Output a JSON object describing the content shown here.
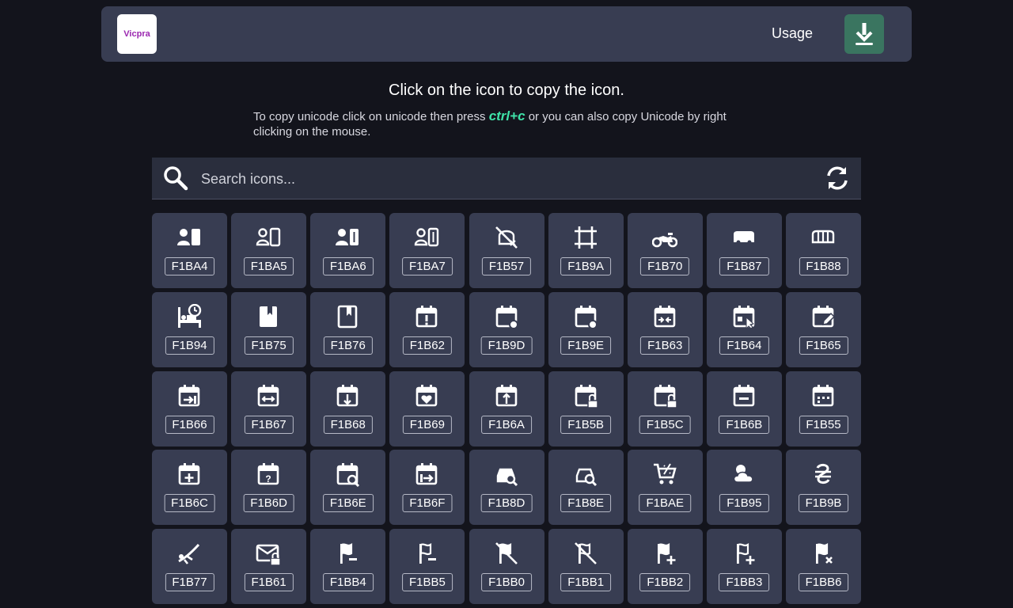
{
  "header": {
    "logo_text": "Vicpra",
    "usage_label": "Usage",
    "download_icon": "download-icon"
  },
  "instructions": {
    "headline": "Click on the icon to copy the icon.",
    "line_before": "To copy unicode click on unicode then press ",
    "shortcut": "ctrl+c",
    "line_after": " or you can also copy Unicode by right clicking on the mouse."
  },
  "search": {
    "placeholder": "Search icons...",
    "value": ""
  },
  "icons": [
    {
      "code": "F1BA4",
      "icon": "account-box-icon"
    },
    {
      "code": "F1BA5",
      "icon": "account-box-outline-icon"
    },
    {
      "code": "F1BA6",
      "icon": "account-box-plus-icon"
    },
    {
      "code": "F1BA7",
      "icon": "account-box-plus-outline-icon"
    },
    {
      "code": "F1B57",
      "icon": "bell-cancel-icon"
    },
    {
      "code": "F1B9A",
      "icon": "border-box-icon"
    },
    {
      "code": "F1B70",
      "icon": "motorbike-icon"
    },
    {
      "code": "F1B87",
      "icon": "bus-side-icon"
    },
    {
      "code": "F1B88",
      "icon": "bus-side-outline-icon"
    },
    {
      "code": "F1B94",
      "icon": "bed-clock-icon"
    },
    {
      "code": "F1B75",
      "icon": "book-bookmark-icon"
    },
    {
      "code": "F1B76",
      "icon": "book-bookmark-outline-icon"
    },
    {
      "code": "F1B62",
      "icon": "calendar-alert-icon"
    },
    {
      "code": "F1B9D",
      "icon": "calendar-badge-icon"
    },
    {
      "code": "F1B9E",
      "icon": "calendar-badge-outline-icon"
    },
    {
      "code": "F1B63",
      "icon": "calendar-collapse-icon"
    },
    {
      "code": "F1B64",
      "icon": "calendar-cursor-icon"
    },
    {
      "code": "F1B65",
      "icon": "calendar-edit-icon"
    },
    {
      "code": "F1B66",
      "icon": "calendar-end-icon"
    },
    {
      "code": "F1B67",
      "icon": "calendar-expand-icon"
    },
    {
      "code": "F1B68",
      "icon": "calendar-export-icon"
    },
    {
      "code": "F1B69",
      "icon": "calendar-heart-icon"
    },
    {
      "code": "F1B6A",
      "icon": "calendar-import-icon"
    },
    {
      "code": "F1B5B",
      "icon": "calendar-lock-open-icon"
    },
    {
      "code": "F1B5C",
      "icon": "calendar-lock-open-outline-icon"
    },
    {
      "code": "F1B6B",
      "icon": "calendar-minus-icon"
    },
    {
      "code": "F1B55",
      "icon": "calendar-dots-icon"
    },
    {
      "code": "F1B6C",
      "icon": "calendar-plus-icon"
    },
    {
      "code": "F1B6D",
      "icon": "calendar-question-icon"
    },
    {
      "code": "F1B6E",
      "icon": "calendar-search-icon"
    },
    {
      "code": "F1B6F",
      "icon": "calendar-start-icon"
    },
    {
      "code": "F1B8D",
      "icon": "car-search-icon"
    },
    {
      "code": "F1B8E",
      "icon": "car-search-outline-icon"
    },
    {
      "code": "F1BAE",
      "icon": "cart-percent-icon"
    },
    {
      "code": "F1B95",
      "icon": "cloud-sun-icon"
    },
    {
      "code": "F1B9B",
      "icon": "currency-hryvnia-icon"
    },
    {
      "code": "F1B77",
      "icon": "diving-icon"
    },
    {
      "code": "F1B61",
      "icon": "email-lock-outline-icon"
    },
    {
      "code": "F1BB4",
      "icon": "flag-minus-icon"
    },
    {
      "code": "F1BB5",
      "icon": "flag-minus-outline-icon"
    },
    {
      "code": "F1BB0",
      "icon": "flag-off-icon"
    },
    {
      "code": "F1BB1",
      "icon": "flag-off-outline-icon"
    },
    {
      "code": "F1BB2",
      "icon": "flag-plus-icon"
    },
    {
      "code": "F1BB3",
      "icon": "flag-plus-outline-icon"
    },
    {
      "code": "F1BB6",
      "icon": "flag-remove-icon"
    }
  ]
}
